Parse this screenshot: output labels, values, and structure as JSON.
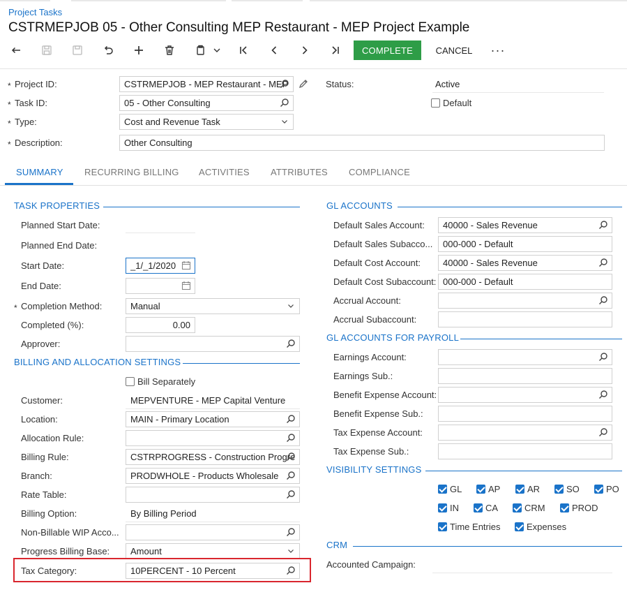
{
  "breadcrumb": "Project Tasks",
  "title": "CSTRMEPJOB 05 - Other Consulting MEP Restaurant - MEP Project Example",
  "toolbar": {
    "complete_label": "COMPLETE",
    "cancel_label": "CANCEL",
    "more_label": "···",
    "icons": [
      "undo-arrow-icon",
      "save-close-icon",
      "save-icon",
      "revert-icon",
      "add-icon",
      "delete-icon",
      "copy-paste-icon",
      "chevron-down-icon",
      "first-record-icon",
      "previous-record-icon",
      "next-record-icon",
      "last-record-icon"
    ]
  },
  "header": {
    "project_id_label": "Project ID:",
    "project_id_value": "CSTRMEPJOB - MEP Restaurant - MEP",
    "task_id_label": "Task ID:",
    "task_id_value": "05 - Other Consulting",
    "type_label": "Type:",
    "type_value": "Cost and Revenue Task",
    "description_label": "Description:",
    "description_value": "Other Consulting",
    "status_label": "Status:",
    "status_value": "Active",
    "default_label": "Default",
    "default_checked": false,
    "required_mark": "*"
  },
  "tabs": [
    {
      "label": "SUMMARY",
      "active": true
    },
    {
      "label": "RECURRING BILLING",
      "active": false
    },
    {
      "label": "ACTIVITIES",
      "active": false
    },
    {
      "label": "ATTRIBUTES",
      "active": false
    },
    {
      "label": "COMPLIANCE",
      "active": false
    }
  ],
  "task_properties": {
    "title": "TASK PROPERTIES",
    "planned_start_label": "Planned Start Date:",
    "planned_end_label": "Planned End Date:",
    "start_date_label": "Start Date:",
    "start_date_value": "_1/_1/2020",
    "end_date_label": "End Date:",
    "completion_method_label": "Completion Method:",
    "completion_method_value": "Manual",
    "completed_label": "Completed (%):",
    "completed_value": "0.00",
    "approver_label": "Approver:"
  },
  "billing": {
    "title": "BILLING AND ALLOCATION SETTINGS",
    "bill_separately_label": "Bill Separately",
    "customer_label": "Customer:",
    "customer_value": "MEPVENTURE - MEP Capital Venture",
    "location_label": "Location:",
    "location_value": "MAIN - Primary Location",
    "allocation_rule_label": "Allocation Rule:",
    "billing_rule_label": "Billing Rule:",
    "billing_rule_value": "CSTRPROGRESS - Construction Progress",
    "branch_label": "Branch:",
    "branch_value": "PRODWHOLE - Products Wholesale",
    "rate_table_label": "Rate Table:",
    "billing_option_label": "Billing Option:",
    "billing_option_value": "By Billing Period",
    "non_billable_label": "Non-Billable WIP Acco...",
    "progress_base_label": "Progress Billing Base:",
    "progress_base_value": "Amount",
    "tax_category_label": "Tax Category:",
    "tax_category_value": "10PERCENT - 10 Percent"
  },
  "gl_accounts": {
    "title": "GL ACCOUNTS",
    "sales_account_label": "Default Sales Account:",
    "sales_account_value": "40000 - Sales Revenue",
    "sales_sub_label": "Default Sales Subacco...",
    "sales_sub_value": "000-000 - Default",
    "cost_account_label": "Default Cost Account:",
    "cost_account_value": "40000 - Sales Revenue",
    "cost_sub_label": "Default Cost Subaccount:",
    "cost_sub_value": "000-000 - Default",
    "accrual_account_label": "Accrual Account:",
    "accrual_sub_label": "Accrual Subaccount:"
  },
  "gl_payroll": {
    "title": "GL ACCOUNTS FOR PAYROLL",
    "earnings_account_label": "Earnings Account:",
    "earnings_sub_label": "Earnings Sub.:",
    "benefit_account_label": "Benefit Expense Account:",
    "benefit_sub_label": "Benefit Expense Sub.:",
    "tax_account_label": "Tax Expense Account:",
    "tax_sub_label": "Tax Expense Sub.:"
  },
  "visibility": {
    "title": "VISIBILITY SETTINGS",
    "items": [
      {
        "label": "GL",
        "checked": true
      },
      {
        "label": "AP",
        "checked": true
      },
      {
        "label": "AR",
        "checked": true
      },
      {
        "label": "SO",
        "checked": true
      },
      {
        "label": "PO",
        "checked": true
      },
      {
        "label": "IN",
        "checked": true
      },
      {
        "label": "CA",
        "checked": true
      },
      {
        "label": "CRM",
        "checked": true
      },
      {
        "label": "PROD",
        "checked": true
      },
      {
        "label": "Time Entries",
        "checked": true
      },
      {
        "label": "Expenses",
        "checked": true
      }
    ]
  },
  "crm": {
    "title": "CRM",
    "accounted_campaign_label": "Accounted Campaign:"
  }
}
